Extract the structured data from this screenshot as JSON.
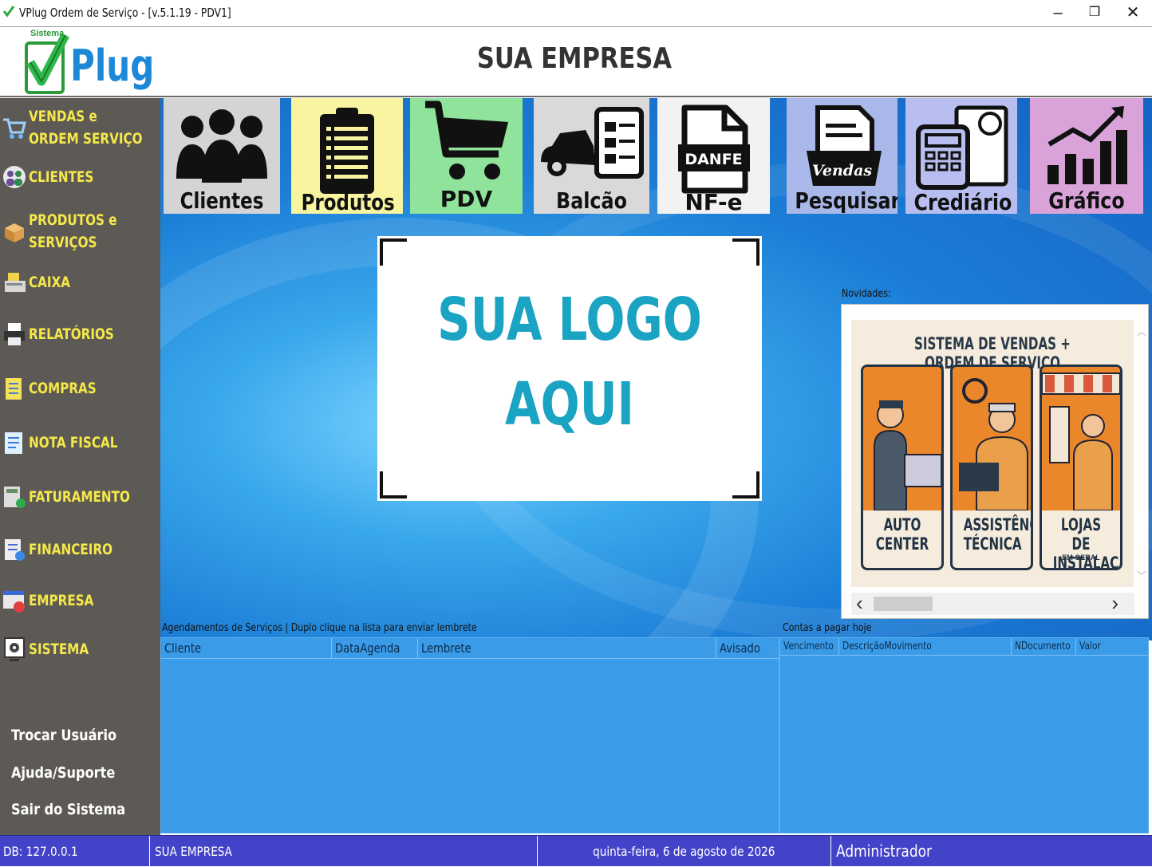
{
  "window": {
    "title": "VPlug Ordem de Serviço - [v.5.1.19  - PDV1]",
    "minimize": "–",
    "maximize": "❐",
    "close": "✕"
  },
  "header": {
    "brand_small": "Sistema",
    "brand": "Plug",
    "company": "SUA EMPRESA"
  },
  "sidebar": {
    "items": [
      {
        "label_line1": "VENDAS e",
        "label_line2": "ORDEM SERVIÇO",
        "icon": "cart-icon"
      },
      {
        "label": "CLIENTES",
        "icon": "clients-icon"
      },
      {
        "label_line1": "PRODUTOS e",
        "label_line2": "SERVIÇOS",
        "icon": "boxes-icon"
      },
      {
        "label": "CAIXA",
        "icon": "cash-register-icon"
      },
      {
        "label": "RELATÓRIOS",
        "icon": "printer-icon"
      },
      {
        "label": "COMPRAS",
        "icon": "clipboard-icon"
      },
      {
        "label": "NOTA FISCAL",
        "icon": "invoice-icon"
      },
      {
        "label": "FATURAMENTO",
        "icon": "calculator-icon"
      },
      {
        "label": "FINANCEIRO",
        "icon": "finance-icon"
      },
      {
        "label": "EMPRESA",
        "icon": "company-icon"
      },
      {
        "label": "SISTEMA",
        "icon": "settings-icon"
      }
    ],
    "bottom": {
      "switch_user": "Trocar Usuário",
      "help": "Ajuda/Suporte",
      "exit": "Sair do Sistema"
    }
  },
  "toolbar": {
    "tiles": [
      {
        "label": "Clientes",
        "bg": "#d4d4d4",
        "icon": "people-icon"
      },
      {
        "label": "Produtos",
        "bg": "#f8f4a0",
        "icon": "list-clipboard-icon"
      },
      {
        "label": "PDV",
        "bg": "#8fe39a",
        "icon": "shopping-cart-icon"
      },
      {
        "label": "Balcão",
        "bg": "#d9d9d9",
        "icon": "car-form-icon"
      },
      {
        "label": "NF-e",
        "bg": "#f2f2f2",
        "icon": "danfe-file-icon",
        "badge": "DANFE"
      },
      {
        "label": "Pesquisar",
        "bg": "#a9b8e8",
        "icon": "search-sales-icon",
        "badge": "Vendas"
      },
      {
        "label": "Crediário",
        "bg": "#b8bff0",
        "icon": "credit-calculator-icon"
      },
      {
        "label": "Gráfico",
        "bg": "#d9a3d9",
        "icon": "bar-chart-icon"
      }
    ]
  },
  "logo_box": {
    "line1": "SUA LOGO",
    "line2": "AQUI"
  },
  "novidades": {
    "label": "Novidades:",
    "heading": "SISTEMA DE VENDAS + ORDEM DE SERVIÇO",
    "columns": [
      {
        "line1": "AUTO",
        "line2": "CENTER",
        "small": ""
      },
      {
        "line1": "ASSISTÊNCIA",
        "line2": "TÉCNICA",
        "small": ""
      },
      {
        "line1": "LOJAS DE",
        "line2": "INSTALAÇÃO",
        "small": "EM GERAL"
      }
    ],
    "scroll_left": "‹",
    "scroll_right": "›"
  },
  "schedule": {
    "caption": "Agendamentos de Serviços | Duplo clique na lista para enviar lembrete",
    "columns": [
      "Cliente",
      "DataAgenda",
      "Lembrete",
      "Avisado"
    ]
  },
  "payables": {
    "caption": "Contas a pagar hoje",
    "columns": [
      "Vencimento",
      "DescriçãoMovimento",
      "NDocumento",
      "Valor"
    ]
  },
  "statusbar": {
    "db": "DB: 127.0.0.1",
    "company": "SUA EMPRESA",
    "date": "quinta-feira, 6 de agosto de 2026",
    "user": "Administrador"
  }
}
